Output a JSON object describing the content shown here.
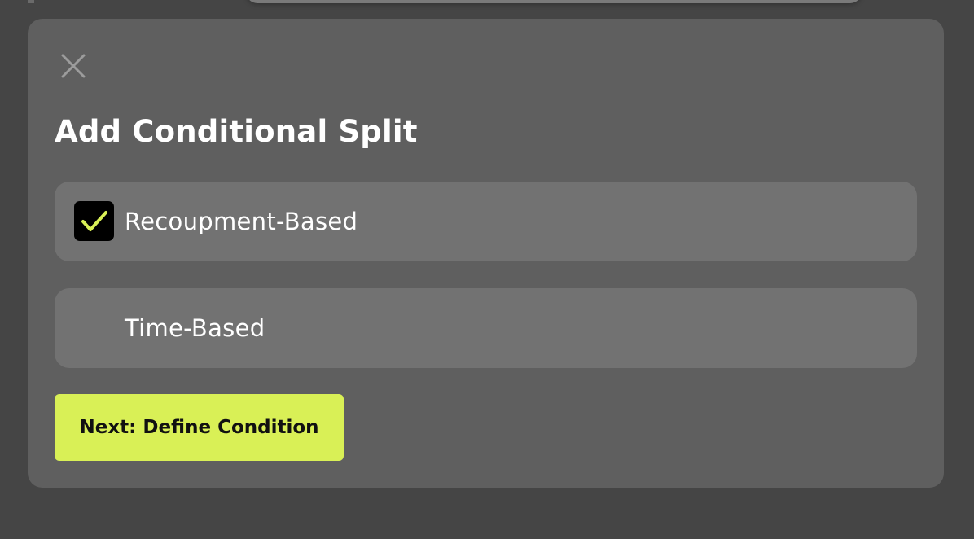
{
  "modal": {
    "title": "Add Conditional Split",
    "close_icon": "close-icon",
    "options": [
      {
        "label": "Recoupment-Based",
        "checked": true
      },
      {
        "label": "Time-Based",
        "checked": false
      }
    ],
    "next_label": "Next: Define Condition"
  },
  "colors": {
    "page_background": "#454545",
    "modal_background": "#5f5f5f",
    "option_background": "#727272",
    "accent": "#d9f056",
    "checkbox_fill": "#000000",
    "check_mark": "#d9f056"
  }
}
